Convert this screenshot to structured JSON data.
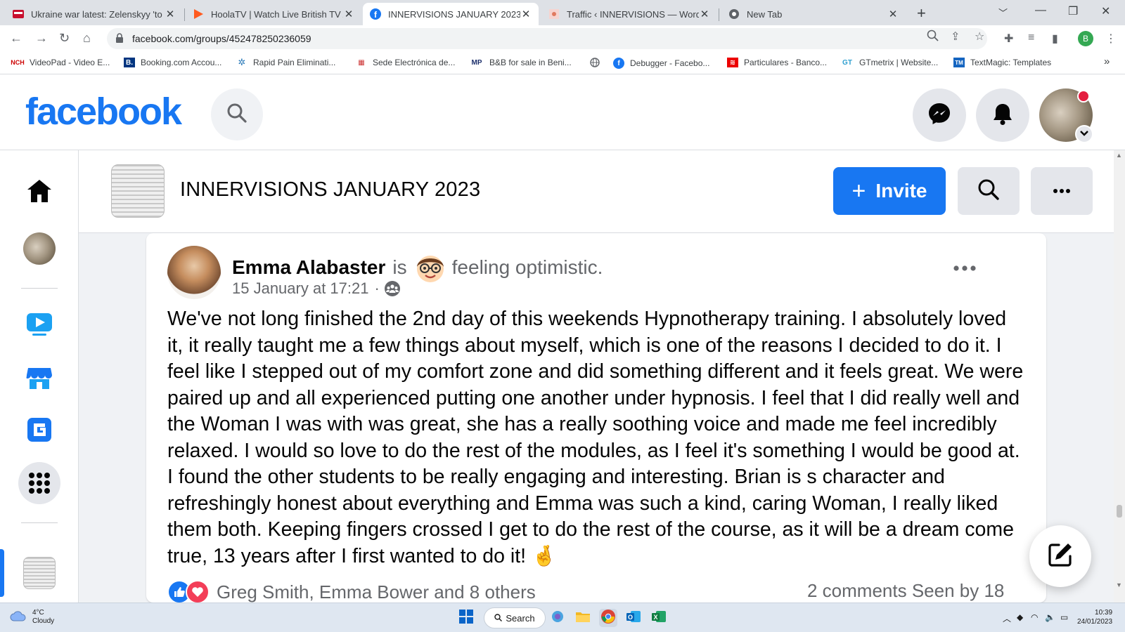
{
  "browser": {
    "tabs": [
      {
        "title": "Ukraine war latest: Zelenskyy 'to",
        "favicon": "sky-news-icon"
      },
      {
        "title": "HoolaTV | Watch Live British TV A",
        "favicon": "play-icon"
      },
      {
        "title": "INNERVISIONS JANUARY 2023 | F",
        "favicon": "facebook-icon"
      },
      {
        "title": "Traffic ‹ INNERVISIONS — WordP",
        "favicon": "wordpress-icon"
      },
      {
        "title": "New Tab",
        "favicon": "chrome-icon"
      }
    ],
    "active_tab": 2,
    "url": "facebook.com/groups/452478250236059",
    "profile_initial": "B",
    "bookmarks": [
      {
        "label": "VideoPad - Video E...",
        "icon": "NCH"
      },
      {
        "label": "Booking.com Accou...",
        "icon": "B."
      },
      {
        "label": "Rapid Pain Eliminati...",
        "icon": "✲"
      },
      {
        "label": "Sede Electrónica de...",
        "icon": "▦"
      },
      {
        "label": "B&B for sale in Beni...",
        "icon": "MP"
      },
      {
        "label": "",
        "icon": "globe-icon"
      },
      {
        "label": "Debugger - Facebo...",
        "icon": "f"
      },
      {
        "label": "Particulares - Banco...",
        "icon": "≋"
      },
      {
        "label": "GTmetrix | Website...",
        "icon": "GT"
      },
      {
        "label": "TextMagic: Templates",
        "icon": "TM"
      }
    ],
    "bookmarks_overflow": "»"
  },
  "facebook": {
    "logo": "facebook",
    "brand_color": "#1877f2",
    "notification_color": "#e41e3f"
  },
  "group": {
    "title": "INNERVISIONS JANUARY 2023",
    "invite_label": "Invite"
  },
  "post": {
    "author": "Emma Alabaster",
    "is_text": "is",
    "feeling": "feeling optimistic.",
    "timestamp": "15 January at 17:21",
    "meta_separator": "·",
    "body": "We've not long finished the 2nd day of this weekends Hypnotherapy training.  I absolutely loved it, it really taught me a few things about myself, which is one of the reasons I decided to do it.  I feel like I stepped out of my comfort zone and did something different and it feels great.  We were paired up and all experienced putting one another under hypnosis.  I feel that I did really well and the Woman I was with was great, she has a really soothing voice and made me feel incredibly relaxed.  I would so love to do the rest of the modules, as I feel it's something I would be good at.  I found the other students to be really engaging and interesting.  Brian is s character and refreshingly honest about everything and Emma was such a kind, caring Woman, I really liked them both.  Keeping fingers crossed I get to do the rest of the course, as it will be a dream come true, 13 years after I first wanted to do it! 🤞",
    "reactions_text": "Greg Smith, Emma Bower and 8 others",
    "comments_text": "2 comments   Seen by 18"
  },
  "taskbar": {
    "weather_temp": "4°C",
    "weather_desc": "Cloudy",
    "search_label": "Search",
    "time": "10:39",
    "date": "24/01/2023"
  }
}
